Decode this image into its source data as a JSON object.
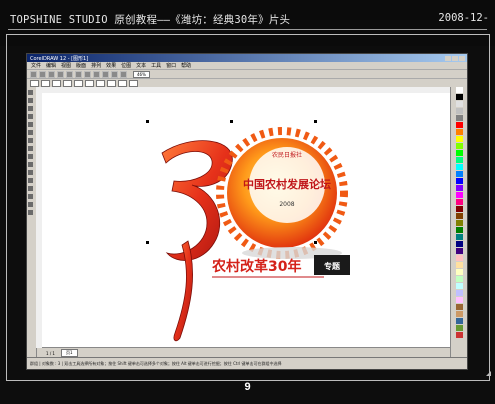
{
  "header": {
    "title": "TOPSHINE STUDIO 原创教程——《潍坊：经典30年》片头",
    "date": "2008-12-"
  },
  "app": {
    "titlebar": "CorelDRAW 12 - [图形1]",
    "menu": [
      "文件",
      "编辑",
      "视图",
      "版面",
      "排列",
      "效果",
      "位图",
      "文本",
      "工具",
      "窗口",
      "帮助"
    ],
    "zoom": "46%",
    "page_tab": "页1",
    "page_counter": "1 / 1",
    "status": "群组 | 对象数 : 3 | 双击工具选择所有对象；按住 Shift 键单击可选择多个对象；按住 Alt 键单击可进行挖掘；按住 Ctrl 键单击可在群组中选择"
  },
  "artwork": {
    "badge_top": "农民日报社",
    "badge_main": "中国农村发展论坛",
    "badge_year": "2008",
    "slogan": "农村改革30年",
    "tag": "专题"
  },
  "palette": [
    "#ffffff",
    "#000000",
    "#e0e0e0",
    "#c0c0c0",
    "#808080",
    "#ff0000",
    "#ff8000",
    "#ffff00",
    "#80ff00",
    "#00ff00",
    "#00ff80",
    "#00ffff",
    "#0080ff",
    "#0000ff",
    "#8000ff",
    "#ff00ff",
    "#ff0080",
    "#800000",
    "#804000",
    "#808000",
    "#008000",
    "#008080",
    "#000080",
    "#400080",
    "#ffc0c0",
    "#ffe0a0",
    "#ffffc0",
    "#c0ffc0",
    "#c0ffff",
    "#c0c0ff",
    "#ffc0ff",
    "#996633",
    "#cc9966",
    "#336699",
    "#669933",
    "#cc3333"
  ],
  "footer": {
    "page_number": "9"
  }
}
